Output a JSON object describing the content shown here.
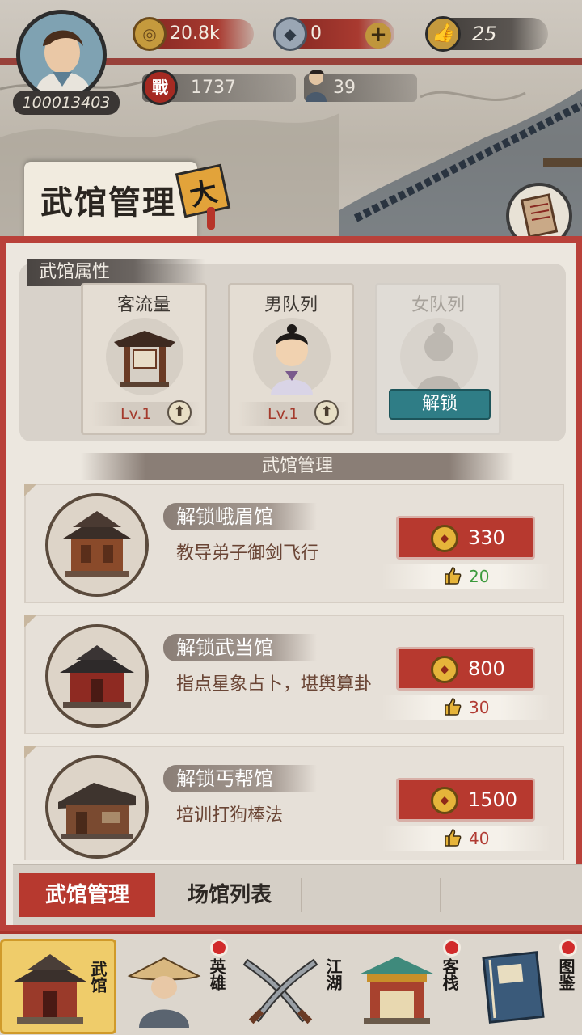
{
  "header": {
    "player_id": "100013403",
    "coins": "20.8k",
    "ingots": "0",
    "likes": "25",
    "power": "1737",
    "people": "39",
    "power_icon_char": "戰"
  },
  "panel": {
    "title": "武馆管理",
    "close_char": "大"
  },
  "attributes": {
    "label": "武馆属性",
    "cards": [
      {
        "title": "客流量",
        "level": "Lv.1"
      },
      {
        "title": "男队列",
        "level": "Lv.1"
      },
      {
        "title": "女队列",
        "button": "解锁"
      }
    ]
  },
  "management": {
    "title": "武馆管理",
    "gyms": [
      {
        "name": "解锁峨眉馆",
        "desc": "教导弟子御剑飞行",
        "price": "330",
        "likes": "20",
        "likes_met": true
      },
      {
        "name": "解锁武当馆",
        "desc": "指点星象占卜，堪舆算卦",
        "price": "800",
        "likes": "30",
        "likes_met": false
      },
      {
        "name": "解锁丐帮馆",
        "desc": "培训打狗棒法",
        "price": "1500",
        "likes": "40",
        "likes_met": false
      }
    ]
  },
  "subtabs": {
    "active": "武馆管理",
    "second": "场馆列表"
  },
  "bottom_nav": [
    {
      "label": "武馆",
      "active": true,
      "badge": false
    },
    {
      "label": "英雄",
      "active": false,
      "badge": true
    },
    {
      "label": "江湖",
      "active": false,
      "badge": false
    },
    {
      "label": "客栈",
      "active": false,
      "badge": true
    },
    {
      "label": "图鉴",
      "active": false,
      "badge": true
    }
  ],
  "colors": {
    "accent_red": "#b7392f",
    "unlock_teal": "#2f7d86",
    "gold": "#e6b43a",
    "like_met": "#3c9a3c",
    "like_unmet": "#b03a32"
  }
}
